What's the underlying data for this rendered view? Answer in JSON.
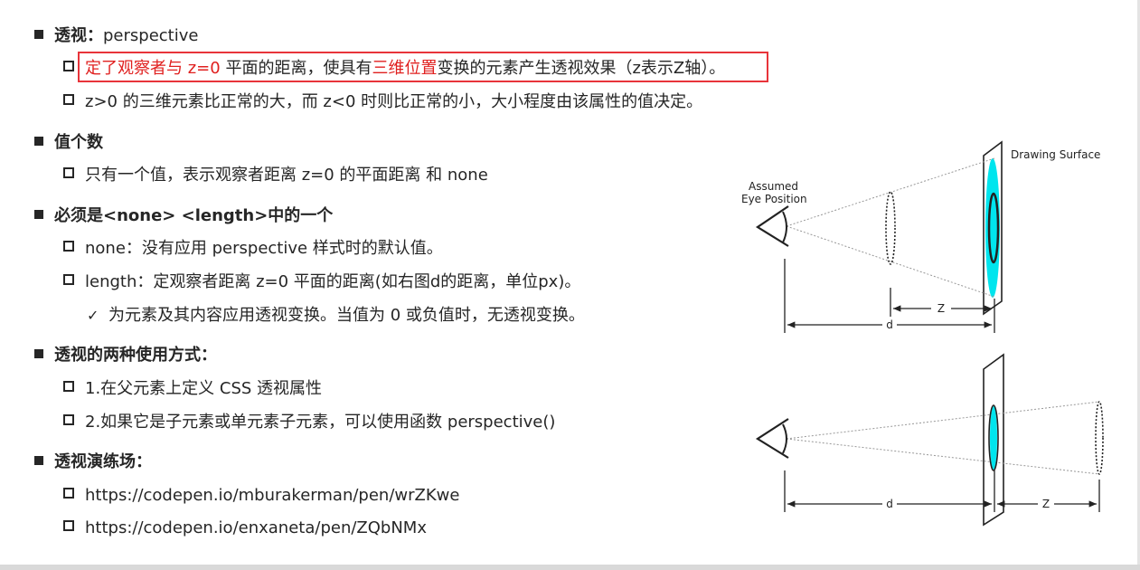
{
  "sections": [
    {
      "heading": "透视：",
      "heading_suffix": "perspective",
      "items": [
        {
          "parts": [
            {
              "text": "定了",
              "red": true
            },
            {
              "text": "观察者与 z=0",
              "red": true
            },
            {
              "text": " 平面的距离，使具有",
              "red": false
            },
            {
              "text": "三维位置",
              "red": true
            },
            {
              "text": "变换的元素产生透视效果（z表示Z轴）。",
              "red": false
            }
          ]
        },
        {
          "text": "z>0 的三维元素比正常的大，而 z<0 时则比正常的小，大小程度由该属性的值决定。"
        }
      ]
    },
    {
      "heading": "值个数",
      "items": [
        {
          "text": "只有一个值，表示观察者距离 z=0 的平面距离 和 none"
        }
      ]
    },
    {
      "heading": "必须是<none> <length>中的一个",
      "items": [
        {
          "text": "none：没有应用 perspective 样式时的默认值。"
        },
        {
          "text": "length：定观察者距离 z=0 平面的距离(如右图d的距离，单位px)。"
        },
        {
          "text": "为元素及其内容应用透视变换。当值为 0 或负值时，无透视变换。",
          "check": "✓"
        }
      ]
    },
    {
      "heading": "透视的两种使用方式：",
      "items": [
        {
          "text": "1.在父元素上定义 CSS 透视属性"
        },
        {
          "text": "2.如果它是子元素或单元素子元素，可以使用函数 perspective()"
        }
      ]
    },
    {
      "heading": "透视演练场：",
      "items": [
        {
          "text": "https://codepen.io/mburakerman/pen/wrZKwe"
        },
        {
          "text": "https://codepen.io/enxaneta/pen/ZQbNMx"
        }
      ]
    }
  ],
  "diagram": {
    "drawing_surface_label": "Drawing Surface",
    "eye_label_line1": "Assumed",
    "eye_label_line2": "Eye Position",
    "label_d": "d",
    "label_z": "Z",
    "colors": {
      "accent_red": "#e0201f",
      "cyan": "#00e5ee",
      "box_border": "#e8343a"
    }
  }
}
